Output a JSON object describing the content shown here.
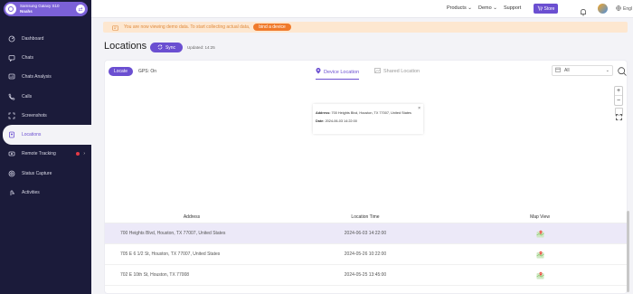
{
  "sidebar": {
    "device_name": "Samsung Galaxy S10",
    "device_sub": "Noahs",
    "items": [
      {
        "label": "Dashboard",
        "icon": "dashboard-icon"
      },
      {
        "label": "Chats",
        "icon": "chat-icon"
      },
      {
        "label": "Chats Analysis",
        "icon": "chat-analysis-icon"
      },
      {
        "label": "Calls",
        "icon": "phone-icon"
      },
      {
        "label": "Screenshots",
        "icon": "screenshot-icon"
      },
      {
        "label": "Locations",
        "icon": "location-icon",
        "active": true
      },
      {
        "label": "Remote Tracking",
        "icon": "remote-tracking-icon"
      },
      {
        "label": "Status Capture",
        "icon": "status-capture-icon"
      },
      {
        "label": "Activities",
        "icon": "activities-icon"
      }
    ]
  },
  "topbar": {
    "products": "Products",
    "demo": "Demo",
    "support": "Support",
    "store": "Store",
    "lang": "Engl"
  },
  "banner": {
    "text": "You are now viewing demo data. To start collecting actual data,",
    "button": "bind a device"
  },
  "page": {
    "title": "Locations",
    "sync": "Sync",
    "updated": "Updated: 14:25"
  },
  "controls": {
    "locate": "Locate",
    "gps": "GPS: On",
    "tab_device": "Device Location",
    "tab_shared": "Shared Location",
    "filter": "All"
  },
  "map": {
    "popup_address_label": "Address:",
    "popup_address": "700 Heights Blvd, Houston, TX 77007, United States",
    "popup_date_label": "Date:",
    "popup_date": "2024-06-03 14:22:00"
  },
  "table": {
    "headers": [
      "Address",
      "Location Time",
      "Map View"
    ],
    "rows": [
      {
        "address": "700 Heights Blvd, Houston, TX 77007, United States",
        "time": "2024-06-03 14:22:00"
      },
      {
        "address": "705 E 6 1/2 St, Houston, TX 77007, United States",
        "time": "2024-05-26 10:22:00"
      },
      {
        "address": "702 E 10th St, Houston, TX 77008",
        "time": "2024-05-25 13:45:00"
      }
    ]
  },
  "colors": {
    "accent": "#6b4fd1",
    "sidebar_bg": "#1b1b3a",
    "banner_bg": "#fde7d0",
    "banner_button": "#f07a2b"
  }
}
